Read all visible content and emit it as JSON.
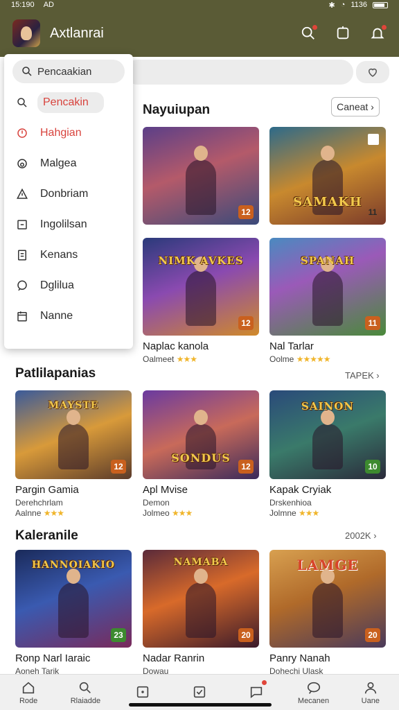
{
  "status": {
    "time": "15:190",
    "carrier": "AD",
    "battery": "1136"
  },
  "app": {
    "title": "Axtlanrai"
  },
  "dropdown": {
    "search_text": "Pencaakian",
    "items": [
      {
        "label": "Pencakin",
        "icon": "search-icon"
      },
      {
        "label": "Hahgian",
        "icon": "fire-icon"
      },
      {
        "label": "Malgea",
        "icon": "refresh-icon"
      },
      {
        "label": "Donbriam",
        "icon": "warning-icon"
      },
      {
        "label": "Ingolilsan",
        "icon": "square-arrow-icon"
      },
      {
        "label": "Kenans",
        "icon": "document-icon"
      },
      {
        "label": "Dglilua",
        "icon": "chat-icon"
      },
      {
        "label": "Nanne",
        "icon": "calendar-icon"
      }
    ]
  },
  "sections": {
    "featured": {
      "title": "Nayuiupan",
      "action": "Caneat",
      "cards": [
        {
          "name": "",
          "sub": "",
          "stars": "",
          "badge": "12",
          "logo": ""
        },
        {
          "name": "",
          "sub": "",
          "stars": "",
          "badge": "11",
          "logo": "SAMAKH"
        },
        {
          "name": "Naplac kanola",
          "sub": "Oalmeet",
          "stars": "★★★",
          "badge": "12",
          "logo": "NIMK AVKES"
        },
        {
          "name": "Nal Tarlar",
          "sub": "Oolme",
          "stars": "★★★★★",
          "badge": "11",
          "logo": "SPANAH"
        }
      ]
    },
    "popular": {
      "title": "Patlilapanias",
      "link": "TAPEK",
      "cards": [
        {
          "name": "Pargin Gamia",
          "sub": "Derehchrlam",
          "sub2": "Aalnne",
          "stars": "★★★",
          "badge": "12",
          "logo": "MAYSTE"
        },
        {
          "name": "Apl Mvise",
          "sub": "Demon",
          "sub2": "Jolmeo",
          "stars": "★★★",
          "badge": "12",
          "logo": "SONDUS"
        },
        {
          "name": "Kapak Cryiak",
          "sub": "Drskenhioa",
          "sub2": "Jolmne",
          "stars": "★★★",
          "badge": "10",
          "logo": "SAINON"
        }
      ]
    },
    "recent": {
      "title": "Kaleranile",
      "link": "2002K",
      "cards": [
        {
          "name": "Ronp Narl Iaraic",
          "sub": "Aoneh Tarik",
          "badge": "23",
          "logo": "HANNOIAKIO"
        },
        {
          "name": "Nadar Ranrin",
          "sub": "Dowau",
          "badge": "20",
          "logo": "NAMABA"
        },
        {
          "name": "Panry Nanah",
          "sub": "Dohechi Ulask",
          "badge": "20",
          "logo": "LAMGE"
        }
      ]
    }
  },
  "bottom_nav": [
    {
      "label": "Rode",
      "icon": "home-icon"
    },
    {
      "label": "Rlaiadde",
      "icon": "search-icon"
    },
    {
      "label": "",
      "icon": "square-icon"
    },
    {
      "label": "",
      "icon": "checkbox-icon"
    },
    {
      "label": "",
      "icon": "chat-icon"
    },
    {
      "label": "Mecanen",
      "icon": "bubble-icon"
    },
    {
      "label": "Uane",
      "icon": "profile-icon"
    }
  ]
}
